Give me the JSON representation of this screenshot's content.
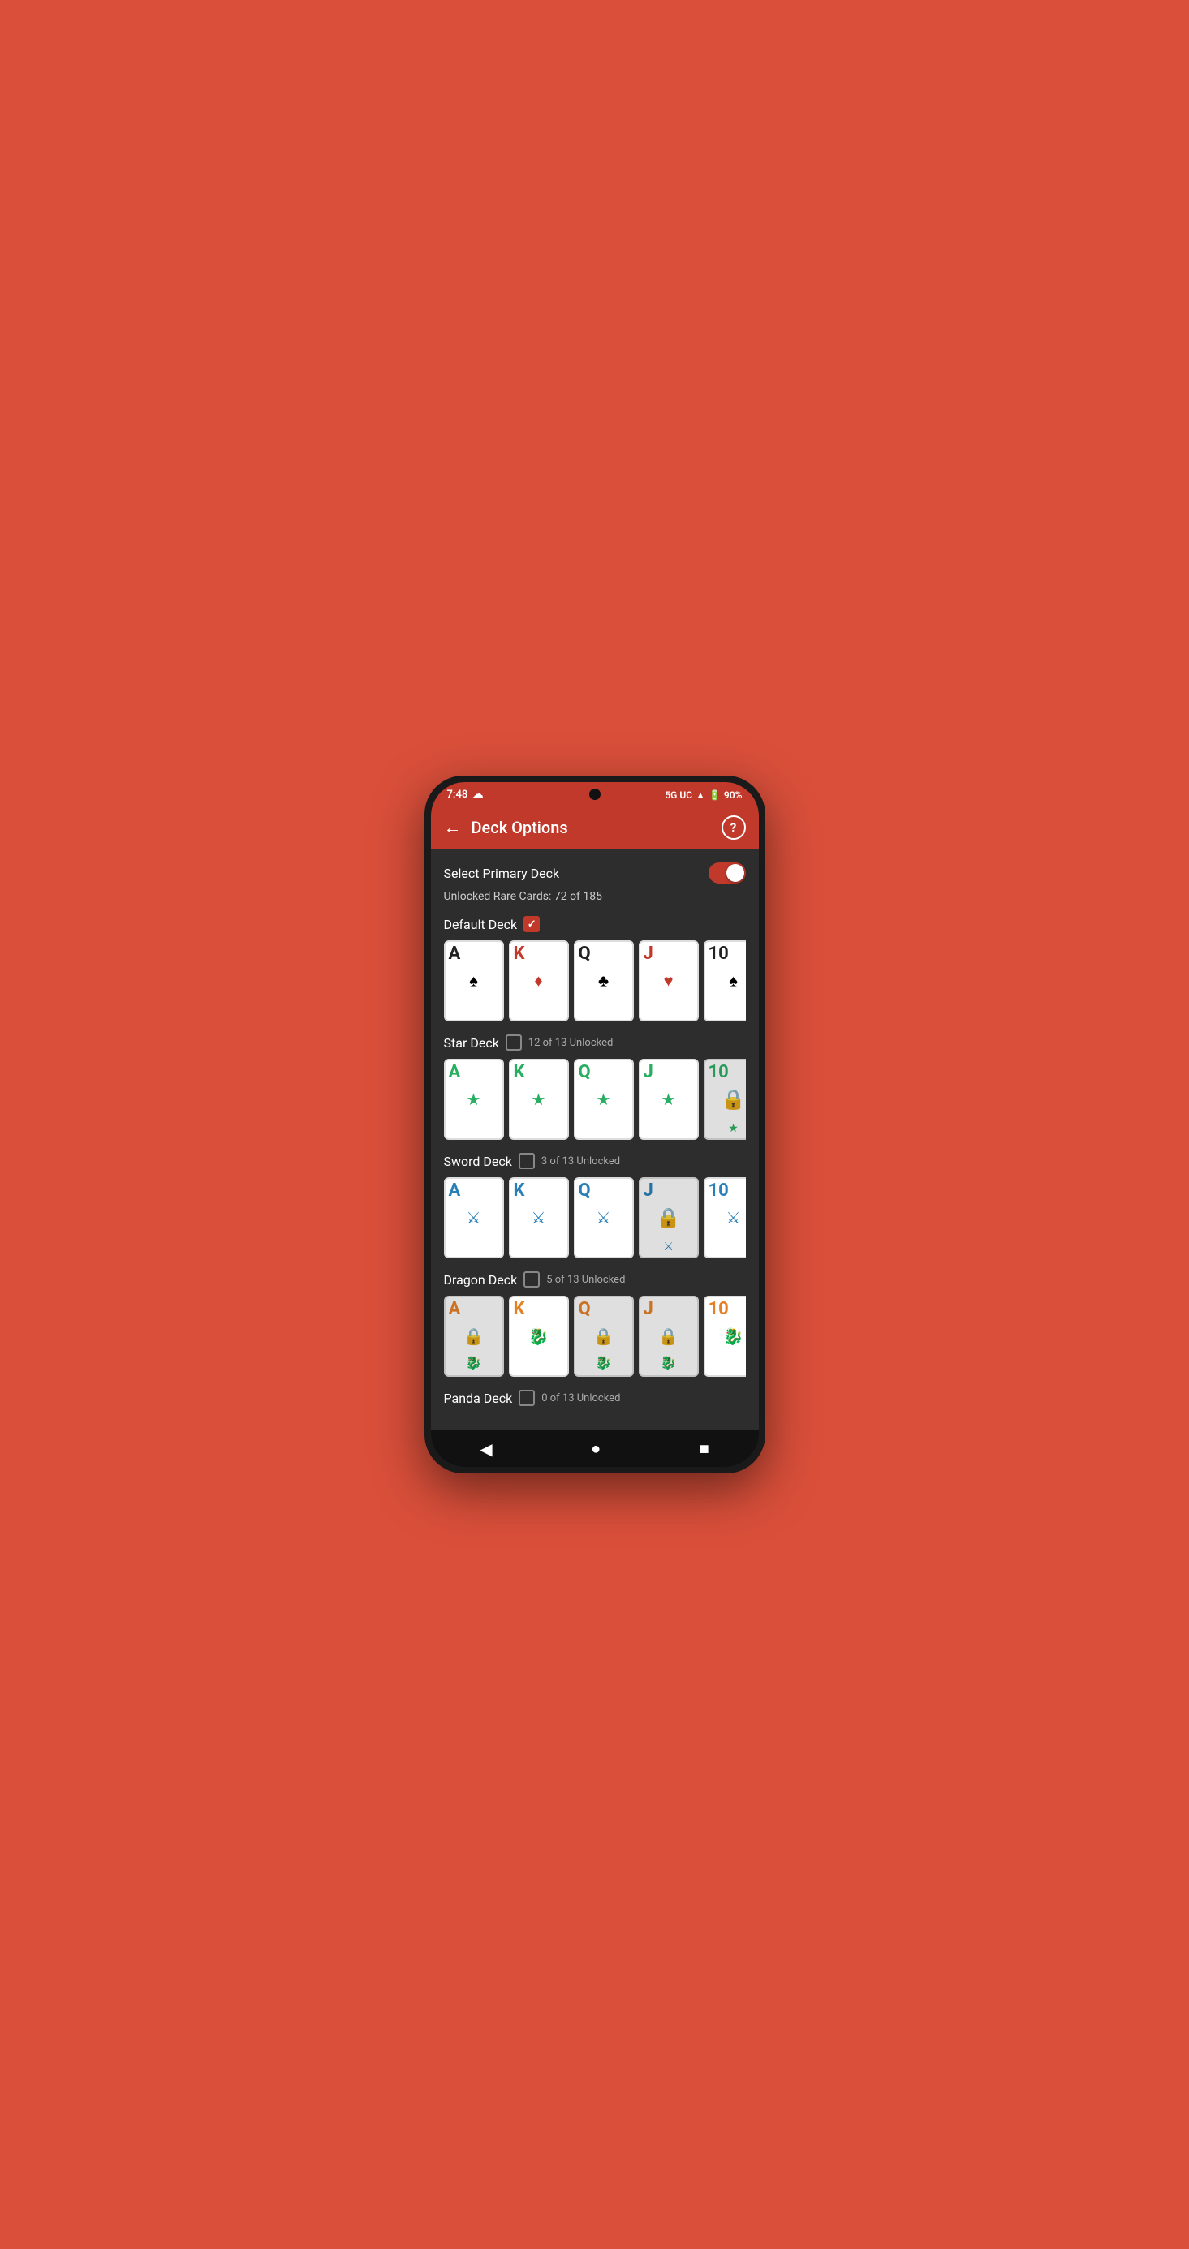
{
  "statusBar": {
    "time": "7:48",
    "network": "5G UC",
    "battery": "90%"
  },
  "header": {
    "title": "Deck Options",
    "backLabel": "←",
    "helpLabel": "?"
  },
  "toggleSection": {
    "label": "Select Primary Deck",
    "unlockedText": "Unlocked Rare Cards: 72 of 185"
  },
  "decks": [
    {
      "name": "Default Deck",
      "checked": true,
      "unlockText": "",
      "cards": [
        {
          "letter": "A",
          "color": "black",
          "symbol": "♠",
          "symbolColor": "black",
          "locked": false
        },
        {
          "letter": "K",
          "color": "red",
          "symbol": "♦",
          "symbolColor": "red",
          "locked": false
        },
        {
          "letter": "Q",
          "color": "black",
          "symbol": "♣",
          "symbolColor": "black",
          "locked": false
        },
        {
          "letter": "J",
          "color": "red",
          "symbol": "♥",
          "symbolColor": "red",
          "locked": false
        },
        {
          "letter": "10",
          "color": "black",
          "symbol": "♠",
          "symbolColor": "black",
          "locked": false
        }
      ]
    },
    {
      "name": "Star Deck",
      "checked": false,
      "unlockText": "12 of 13 Unlocked",
      "cards": [
        {
          "letter": "A",
          "color": "green",
          "symbol": "★",
          "symbolColor": "green",
          "locked": false
        },
        {
          "letter": "K",
          "color": "green",
          "symbol": "★",
          "symbolColor": "green",
          "locked": false
        },
        {
          "letter": "Q",
          "color": "green",
          "symbol": "★",
          "symbolColor": "green",
          "locked": false
        },
        {
          "letter": "J",
          "color": "green",
          "symbol": "★",
          "symbolColor": "green",
          "locked": false
        },
        {
          "letter": "10",
          "color": "green",
          "symbol": "★",
          "symbolColor": "green",
          "locked": true
        }
      ]
    },
    {
      "name": "Sword Deck",
      "checked": false,
      "unlockText": "3 of 13 Unlocked",
      "cards": [
        {
          "letter": "A",
          "color": "blue",
          "symbol": "🗡",
          "symbolColor": "blue",
          "locked": false
        },
        {
          "letter": "K",
          "color": "blue",
          "symbol": "🗡",
          "symbolColor": "blue",
          "locked": false
        },
        {
          "letter": "Q",
          "color": "blue",
          "symbol": "🗡",
          "symbolColor": "blue",
          "locked": false
        },
        {
          "letter": "J",
          "color": "blue",
          "symbol": "🗡",
          "symbolColor": "blue",
          "locked": true
        },
        {
          "letter": "10",
          "color": "blue",
          "symbol": "🗡",
          "symbolColor": "blue",
          "locked": false
        }
      ]
    },
    {
      "name": "Dragon Deck",
      "checked": false,
      "unlockText": "5 of 13 Unlocked",
      "cards": [
        {
          "letter": "A",
          "color": "orange",
          "symbol": "🐉",
          "symbolColor": "orange",
          "locked": true
        },
        {
          "letter": "K",
          "color": "orange",
          "symbol": "🐉",
          "symbolColor": "orange",
          "locked": false
        },
        {
          "letter": "Q",
          "color": "orange",
          "symbol": "🐉",
          "symbolColor": "orange",
          "locked": true
        },
        {
          "letter": "J",
          "color": "orange",
          "symbol": "🐉",
          "symbolColor": "orange",
          "locked": true
        },
        {
          "letter": "10",
          "color": "orange",
          "symbol": "🐉",
          "symbolColor": "orange",
          "locked": false
        }
      ]
    },
    {
      "name": "Panda Deck",
      "checked": false,
      "unlockText": "0 of 13 Unlocked",
      "cards": []
    }
  ],
  "bottomNav": {
    "back": "◀",
    "home": "●",
    "recent": "■"
  }
}
